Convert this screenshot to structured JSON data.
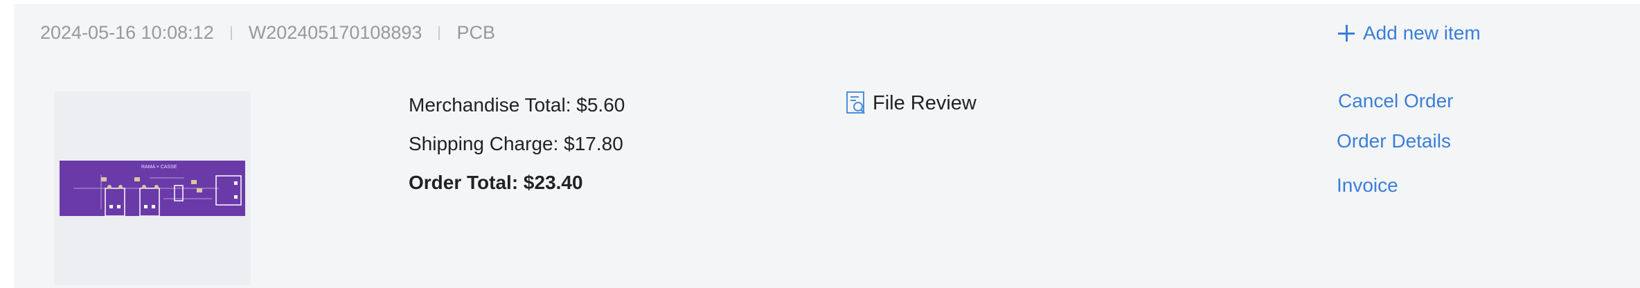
{
  "order": {
    "datetime": "2024-05-16 10:08:12",
    "order_no": "W202405170108893",
    "product_type": "PCB"
  },
  "add_item_label": "Add new item",
  "thumbnail": {
    "board_color": "#6a3aa8",
    "silkscreen_text": "RAMA × CASSE"
  },
  "totals": {
    "merchandise": "Merchandise Total: $5.60",
    "shipping": "Shipping Charge: $17.80",
    "order_total": "Order Total: $23.40"
  },
  "file_review_label": "File Review",
  "actions": {
    "cancel": "Cancel Order",
    "details": "Order Details",
    "invoice": "Invoice"
  },
  "colors": {
    "link": "#3a7fd6",
    "muted": "#999999",
    "card_bg": "#f4f5f7"
  },
  "icons": [
    "plus-icon",
    "file-review-icon"
  ]
}
